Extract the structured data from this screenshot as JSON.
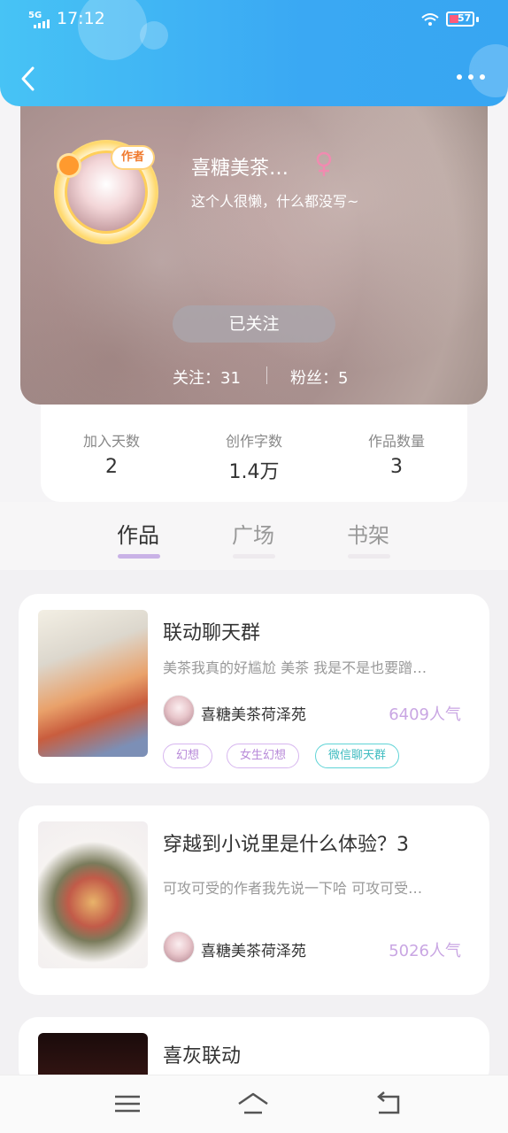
{
  "status_bar": {
    "network": "5G",
    "time": "17:12",
    "battery": "57"
  },
  "profile": {
    "author_badge": "作者",
    "username": "喜糖美茶…",
    "gender_symbol": "♀",
    "bio": "这个人很懒，什么都没写~",
    "follow_button": "已关注",
    "following_label": "关注：31",
    "fans_label": "粉丝：5"
  },
  "stats": [
    {
      "label": "加入天数",
      "value": "2"
    },
    {
      "label": "创作字数",
      "value": "1.4万"
    },
    {
      "label": "作品数量",
      "value": "3"
    }
  ],
  "tabs": [
    {
      "label": "作品",
      "active": true
    },
    {
      "label": "广场",
      "active": false
    },
    {
      "label": "书架",
      "active": false
    }
  ],
  "works": [
    {
      "title": "联动聊天群",
      "description": "美茶我真的好尴尬 美茶 我是不是也要蹭…",
      "author": "喜糖美茶荷泽苑",
      "popularity": "6409人气",
      "tags": [
        "幻想",
        "女生幻想",
        "微信聊天群"
      ]
    },
    {
      "title": "穿越到小说里是什么体验？3",
      "description": "可攻可受的作者我先说一下哈 可攻可受…",
      "author": "喜糖美茶荷泽苑",
      "popularity": "5026人气",
      "tags": []
    },
    {
      "title": "喜灰联动",
      "description": "",
      "author": "",
      "popularity": "",
      "tags": []
    }
  ],
  "colors": {
    "header": "#3aa8f3",
    "accent_purple": "#c9b2e6",
    "tag_cyan": "#3fbcc0"
  },
  "icons": [
    "back-arrow-icon",
    "more-dots-icon",
    "female-icon",
    "menu-icon",
    "home-icon",
    "return-icon"
  ]
}
